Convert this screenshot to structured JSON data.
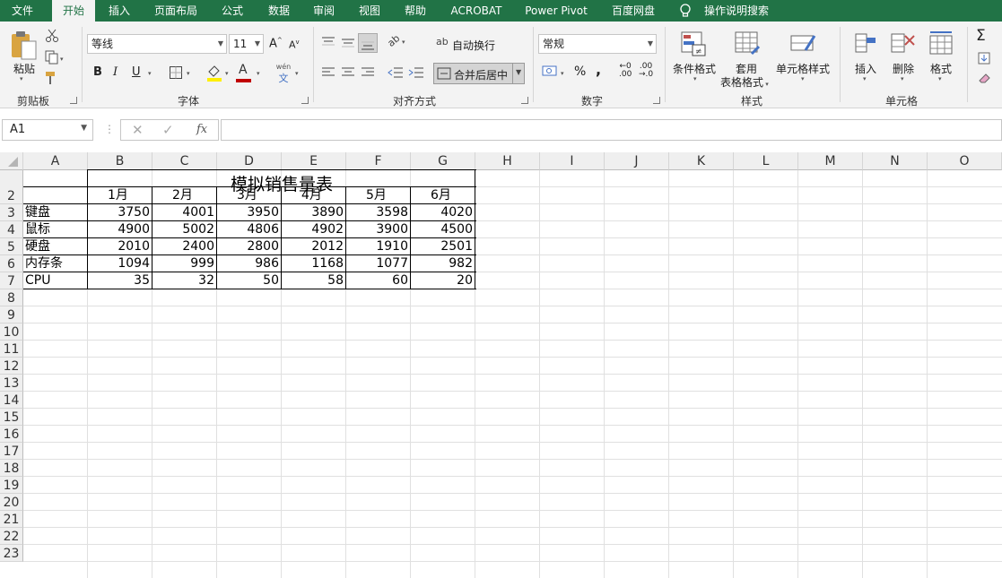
{
  "menu": {
    "tabs": [
      {
        "label": "文件"
      },
      {
        "label": "开始"
      },
      {
        "label": "插入"
      },
      {
        "label": "页面布局"
      },
      {
        "label": "公式"
      },
      {
        "label": "数据"
      },
      {
        "label": "审阅"
      },
      {
        "label": "视图"
      },
      {
        "label": "帮助"
      },
      {
        "label": "ACROBAT"
      },
      {
        "label": "Power Pivot"
      },
      {
        "label": "百度网盘"
      },
      {
        "label": "操作说明搜索"
      }
    ],
    "active_tab": "开始"
  },
  "ribbon": {
    "clipboard": {
      "paste_label": "粘贴",
      "group_label": "剪贴板"
    },
    "font": {
      "font_name": "等线",
      "font_size": "11",
      "group_label": "字体",
      "bold": "B",
      "italic": "I",
      "underline": "U",
      "grow": "A",
      "shrink": "A",
      "phonetic_top": "wén",
      "phonetic_bottom": "文",
      "font_color_letter": "A"
    },
    "alignment": {
      "wrap_text": "自动换行",
      "merge_center": "合并后居中",
      "group_label": "对齐方式",
      "orient_glyph": "ab",
      "wrap_glyph": "ab"
    },
    "number": {
      "format": "常规",
      "percent": "%",
      "comma": ",",
      "inc_decimal_top": "←0",
      "inc_decimal_bottom": ".00",
      "dec_decimal_top": ".00",
      "dec_decimal_bottom": "→.0",
      "group_label": "数字"
    },
    "styles": {
      "conditional": "条件格式",
      "table_format_1": "套用",
      "table_format_2": "表格格式",
      "cell_styles": "单元格样式",
      "group_label": "样式"
    },
    "cells": {
      "insert": "插入",
      "delete": "删除",
      "format": "格式",
      "group_label": "单元格"
    },
    "editing": {
      "sum": "Σ"
    }
  },
  "formula_bar": {
    "name_box": "A1",
    "fx": "fx",
    "formula": ""
  },
  "sheet": {
    "columns": [
      "A",
      "B",
      "C",
      "D",
      "E",
      "F",
      "G",
      "H",
      "I",
      "J",
      "K",
      "L",
      "M",
      "N",
      "O"
    ],
    "rows": [
      "1",
      "2",
      "3",
      "4",
      "5",
      "6",
      "7",
      "8",
      "9",
      "10",
      "11",
      "12",
      "13",
      "14",
      "15",
      "16",
      "17",
      "18",
      "19",
      "20",
      "21",
      "22",
      "23"
    ],
    "title": "模拟销售量表",
    "months": [
      "1月",
      "2月",
      "3月",
      "4月",
      "5月",
      "6月"
    ],
    "data": [
      {
        "name": "键盘",
        "values": [
          "3750",
          "4001",
          "3950",
          "3890",
          "3598",
          "4020"
        ]
      },
      {
        "name": "鼠标",
        "values": [
          "4900",
          "5002",
          "4806",
          "4902",
          "3900",
          "4500"
        ]
      },
      {
        "name": "硬盘",
        "values": [
          "2010",
          "2400",
          "2800",
          "2012",
          "1910",
          "2501"
        ]
      },
      {
        "name": "内存条",
        "values": [
          "1094",
          "999",
          "986",
          "1168",
          "1077",
          "982"
        ]
      },
      {
        "name": "CPU",
        "values": [
          "35",
          "32",
          "50",
          "58",
          "60",
          "20"
        ]
      }
    ]
  },
  "colors": {
    "accent": "#217346",
    "ribbon_bg": "#f3f3f3",
    "header_bg": "#efefef"
  }
}
